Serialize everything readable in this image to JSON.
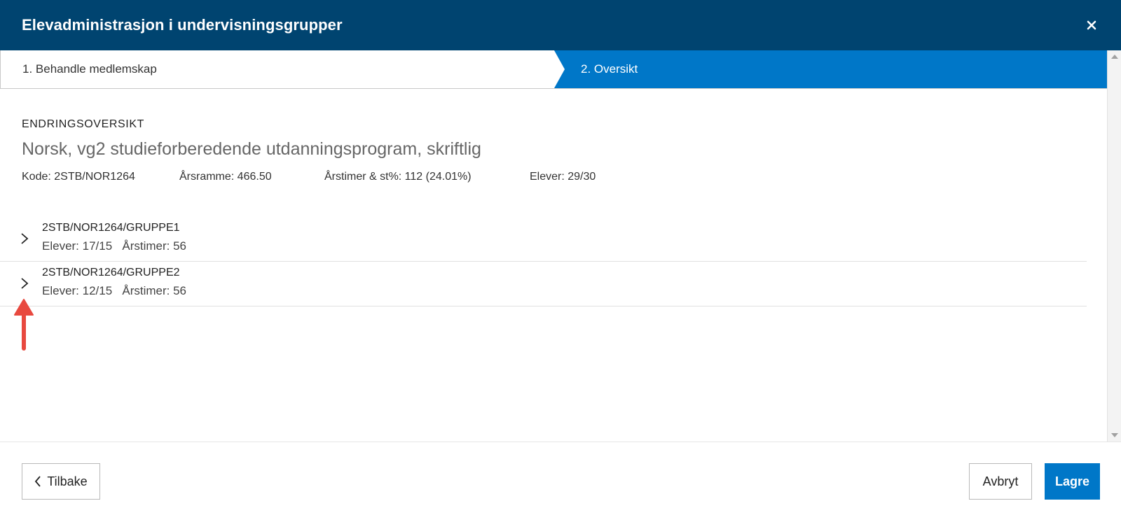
{
  "header": {
    "title": "Elevadministrasjon i undervisningsgrupper"
  },
  "steps": [
    {
      "label": "1. Behandle medlemskap",
      "active": false
    },
    {
      "label": "2. Oversikt",
      "active": true
    }
  ],
  "overview": {
    "section_label": "ENDRINGSOVERSIKT",
    "subject_title": "Norsk, vg2 studieforberedende utdanningsprogram, skriftlig",
    "meta": {
      "kode": "Kode: 2STB/NOR1264",
      "arsramme": "Årsramme: 466.50",
      "arstimer": "Årstimer & st%: 112 (24.01%)",
      "elever": "Elever: 29/30"
    }
  },
  "groups": [
    {
      "name": "2STB/NOR1264/GRUPPE1",
      "elever": "Elever: 17/15",
      "arstimer": "Årstimer: 56"
    },
    {
      "name": "2STB/NOR1264/GRUPPE2",
      "elever": "Elever: 12/15",
      "arstimer": "Årstimer: 56"
    }
  ],
  "footer": {
    "back_label": "Tilbake",
    "cancel_label": "Avbryt",
    "save_label": "Lagre"
  },
  "colors": {
    "header_bg": "#004470",
    "active_step_bg": "#0077c8",
    "primary_button": "#0077c8",
    "annotation_arrow": "#e8493f"
  },
  "icons": {
    "close": "close-icon",
    "expand": "chevron-right-icon",
    "back": "chevron-left-icon"
  }
}
